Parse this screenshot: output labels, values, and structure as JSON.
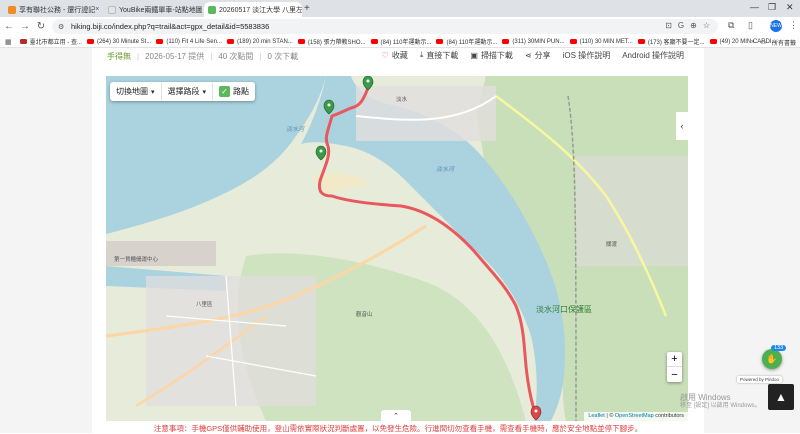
{
  "tabs": [
    {
      "title": "享有聯社公務 - 還行證記",
      "fav_color": "#f28b20",
      "active": false
    },
    {
      "title": "YouBike兩鐵單車-站點地圖",
      "fav_color": "#e5e5e5",
      "active": false
    },
    {
      "title": "20260517 淡江大學 八里左岸 |",
      "fav_color": "#5cb85c",
      "active": true
    }
  ],
  "address": "hiking.biji.co/index.php?q=trail&act=gpx_detail&id=5583836",
  "bookmarks": [
    {
      "label": "臺北市都立用 - 查...",
      "type": "grid"
    },
    {
      "label": "(264) 30 Minute St...",
      "type": "yt"
    },
    {
      "label": "(110) Fit 4 Life Sen...",
      "type": "yt"
    },
    {
      "label": "(189) 20 min STAN...",
      "type": "yt"
    },
    {
      "label": "(158) 張力帶教SHO...",
      "type": "yt"
    },
    {
      "label": "(84) 110年運動示...",
      "type": "yt"
    },
    {
      "label": "(84) 110年運動示...",
      "type": "yt"
    },
    {
      "label": "(311) 30MIN PUN...",
      "type": "yt"
    },
    {
      "label": "(110) 30 MIN MET...",
      "type": "yt"
    },
    {
      "label": "(173) 客廳不要一定...",
      "type": "yt"
    },
    {
      "label": "(49) 20 MIN CARDI...",
      "type": "yt"
    }
  ],
  "bookmarks_more": "»",
  "bookmarks_all": "所有書籤",
  "profile_initials": "NEW",
  "meta": {
    "author": "手得無",
    "date": "2026-05-17 提供",
    "views": "40 次點閱",
    "downloads": "0 次下載"
  },
  "actions": {
    "favorite": "收藏",
    "direct_download": "直接下載",
    "qr_download": "掃描下載",
    "share": "分享",
    "ios": "iOS 操作說明",
    "android": "Android 操作說明"
  },
  "map_controls": {
    "switch_map": "切換地圖",
    "select_segment": "選擇路段",
    "waypoints": "路點"
  },
  "zoom": {
    "in": "+",
    "out": "−"
  },
  "attribution": {
    "leaflet": "Leaflet",
    "sep": " | © ",
    "osm": "OpenStreetMap",
    "suffix": " contributors"
  },
  "map_labels": {
    "river": "淡水河",
    "park": "淡水河口保護區",
    "bali": "八里區",
    "port": "第一貨櫃儲運中心",
    "tamsui": "淡水",
    "guandu": "關渡",
    "guanyin": "觀音山"
  },
  "warning": "注意事項：手機GPS僅供輔助使用，登山需依實際狀況判斷處置，以免發生危險。行進間切勿查看手機，需查看手機時，應於安全地點並停下腳步。",
  "widgets": {
    "badge": "133",
    "powered": "Powered by Pindoo",
    "to_top": "▲",
    "activate_title": "啟用 Windows",
    "activate_sub": "移至 [設定] 以啟用 Windows。"
  }
}
